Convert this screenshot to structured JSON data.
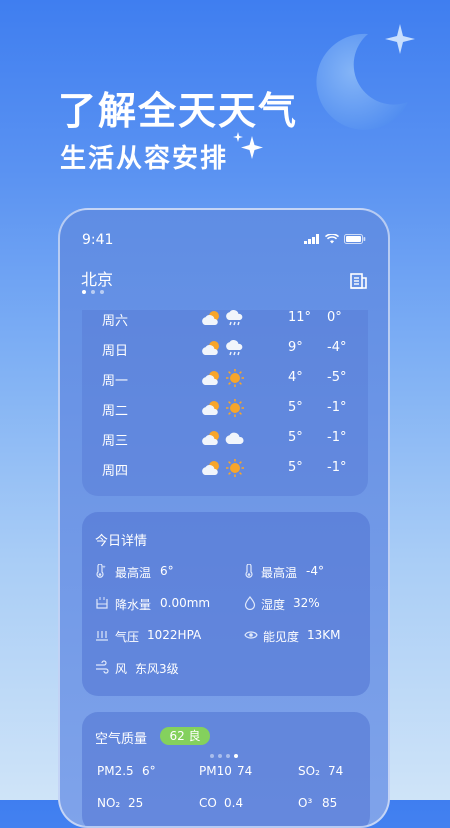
{
  "promo": {
    "headline": "了解全天天气",
    "subline": "生活从容安排"
  },
  "status_bar": {
    "time": "9:41"
  },
  "location": {
    "city": "北京",
    "page_count": 3,
    "active_page": 0
  },
  "forecast": {
    "rows": [
      {
        "day": "周六",
        "icons": [
          "partly-cloudy-icon",
          "rain-cloud-icon"
        ],
        "high": "11°",
        "low": "0°"
      },
      {
        "day": "周日",
        "icons": [
          "partly-cloudy-icon",
          "rain-cloud-icon"
        ],
        "high": "9°",
        "low": "-4°"
      },
      {
        "day": "周一",
        "icons": [
          "partly-cloudy-icon",
          "sun-icon"
        ],
        "high": "4°",
        "low": "-5°"
      },
      {
        "day": "周二",
        "icons": [
          "partly-cloudy-icon",
          "sun-icon"
        ],
        "high": "5°",
        "low": "-1°"
      },
      {
        "day": "周三",
        "icons": [
          "partly-cloudy-icon",
          "cloud-icon"
        ],
        "high": "5°",
        "low": "-1°"
      },
      {
        "day": "周四",
        "icons": [
          "partly-cloudy-icon",
          "sun-icon"
        ],
        "high": "5°",
        "low": "-1°"
      }
    ]
  },
  "details": {
    "title": "今日详情",
    "max_temp_label": "最高温",
    "max_temp_value": "6°",
    "min_temp_label": "最高温",
    "min_temp_value": "-4°",
    "precip_label": "降水量",
    "precip_value": "0.00mm",
    "humidity_label": "湿度",
    "humidity_value": "32%",
    "pressure_label": "气压",
    "pressure_value": "1022HPA",
    "visibility_label": "能见度",
    "visibility_value": "13KM",
    "wind_label": "风",
    "wind_value": "东风3级"
  },
  "air": {
    "title": "空气质量",
    "badge": "62 良",
    "pm25_label": "PM2.5",
    "pm25_value": "6°",
    "pm10_label": "PM10",
    "pm10_value": "74",
    "so2_label": "SO₂",
    "so2_value": "74",
    "no2_label": "NO₂",
    "no2_value": "25",
    "co_label": "CO",
    "co_value": "0.4",
    "o3_label": "O³",
    "o3_value": "85",
    "page_count": 4,
    "active_page": 3
  },
  "colors": {
    "badge_green": "#84d15d",
    "sun": "#f7a52a",
    "cloud": "#f1f5fb"
  }
}
